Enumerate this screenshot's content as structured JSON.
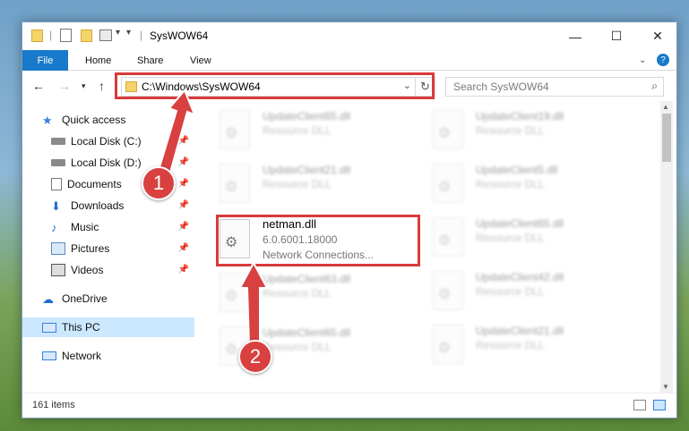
{
  "window": {
    "title": "SysWOW64",
    "controls": {
      "minimize": "—",
      "maximize": "☐",
      "close": "✕"
    }
  },
  "ribbon": {
    "file": "File",
    "tabs": [
      "Home",
      "Share",
      "View"
    ]
  },
  "nav": {
    "address": "C:\\Windows\\SysWOW64",
    "search_placeholder": "Search SysWOW64"
  },
  "sidebar": {
    "items": [
      {
        "label": "Quick access",
        "icon": "star-icon"
      },
      {
        "label": "Local Disk (C:)",
        "icon": "drive-icon"
      },
      {
        "label": "Local Disk (D:)",
        "icon": "drive-icon"
      },
      {
        "label": "Documents",
        "icon": "documents-icon"
      },
      {
        "label": "Downloads",
        "icon": "downloads-icon"
      },
      {
        "label": "Music",
        "icon": "music-icon"
      },
      {
        "label": "Pictures",
        "icon": "pictures-icon"
      },
      {
        "label": "Videos",
        "icon": "videos-icon"
      },
      {
        "label": "OneDrive",
        "icon": "cloud-icon"
      },
      {
        "label": "This PC",
        "icon": "computer-icon"
      },
      {
        "label": "Network",
        "icon": "network-icon"
      }
    ]
  },
  "files": {
    "left": [
      {
        "name": "UpdateClient65.dll",
        "sub": "Resource DLL"
      },
      {
        "name": "UpdateClient21.dll",
        "sub": "Resource DLL"
      },
      {
        "name": "UpdateClient63.dll",
        "sub": "Resource DLL"
      },
      {
        "name": "UpdateClient65.dll",
        "sub": "Resource DLL"
      }
    ],
    "right": [
      {
        "name": "UpdateClient19.dll",
        "sub": "Resource DLL"
      },
      {
        "name": "UpdateClient5.dll",
        "sub": "Resource DLL"
      },
      {
        "name": "UpdateClient65.dll",
        "sub": "Resource DLL"
      },
      {
        "name": "UpdateClient42.dll",
        "sub": "Resource DLL"
      },
      {
        "name": "UpdateClient21.dll",
        "sub": "Resource DLL"
      }
    ],
    "highlighted": {
      "name": "netman.dll",
      "version": "6.0.6001.18000",
      "description": "Network Connections..."
    }
  },
  "status": {
    "item_count": "161 items"
  },
  "callouts": [
    "1",
    "2"
  ],
  "colors": {
    "accent": "#1979ca",
    "highlight": "#d93b3b",
    "selection": "#cce8ff"
  }
}
